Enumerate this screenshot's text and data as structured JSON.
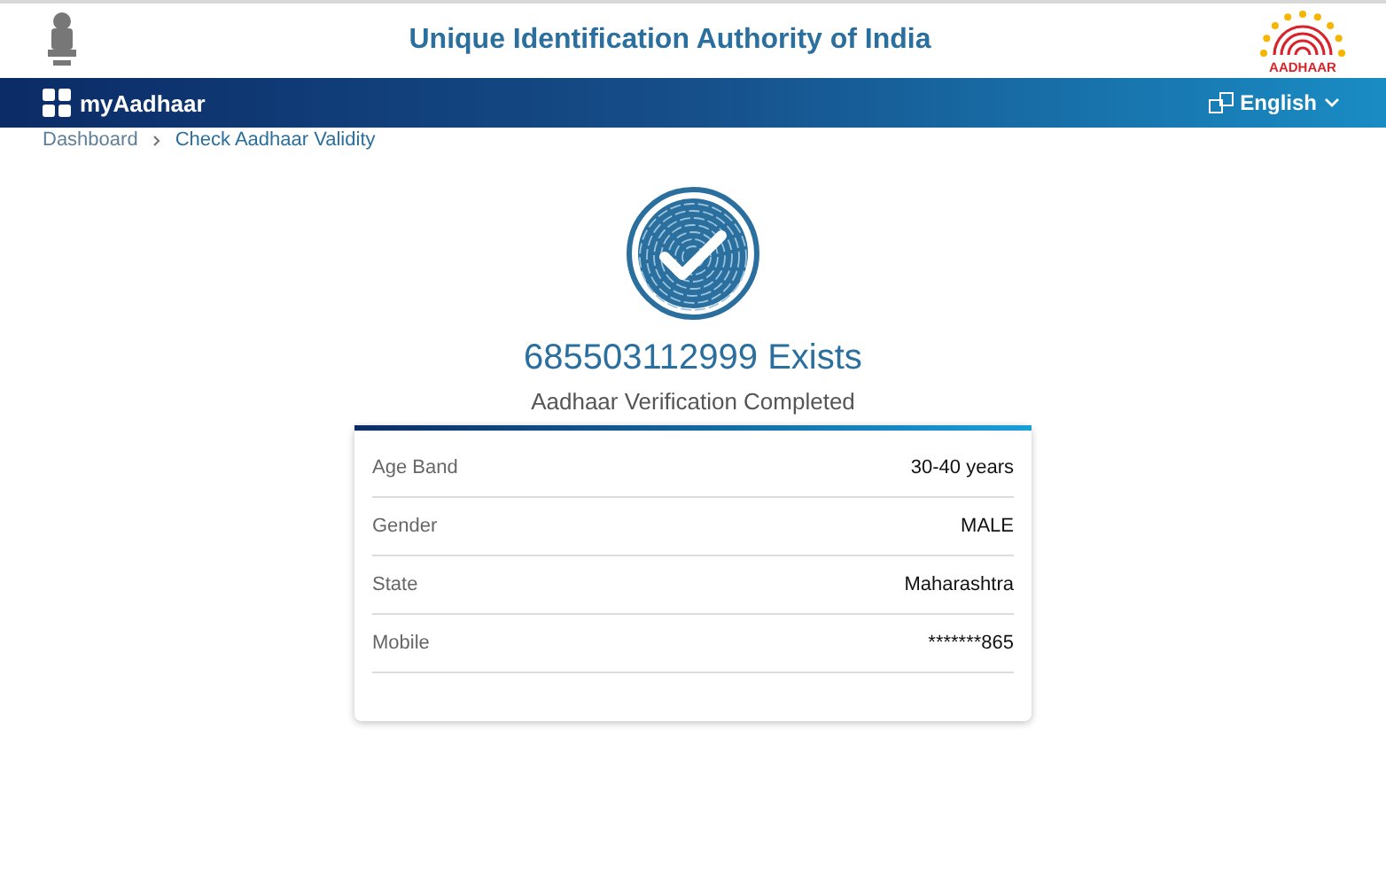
{
  "header": {
    "title": "Unique Identification Authority of India",
    "logo_text": "AADHAAR"
  },
  "navbar": {
    "brand": "myAadhaar",
    "language": "English"
  },
  "breadcrumb": [
    {
      "label": "Dashboard"
    },
    {
      "label": "Check Aadhaar Validity"
    }
  ],
  "result": {
    "heading": "685503112999 Exists",
    "subtitle": "Aadhaar Verification Completed"
  },
  "details": [
    {
      "label": "Age Band",
      "value": "30-40 years"
    },
    {
      "label": "Gender",
      "value": "MALE"
    },
    {
      "label": "State",
      "value": "Maharashtra"
    },
    {
      "label": "Mobile",
      "value": "*******865"
    }
  ]
}
